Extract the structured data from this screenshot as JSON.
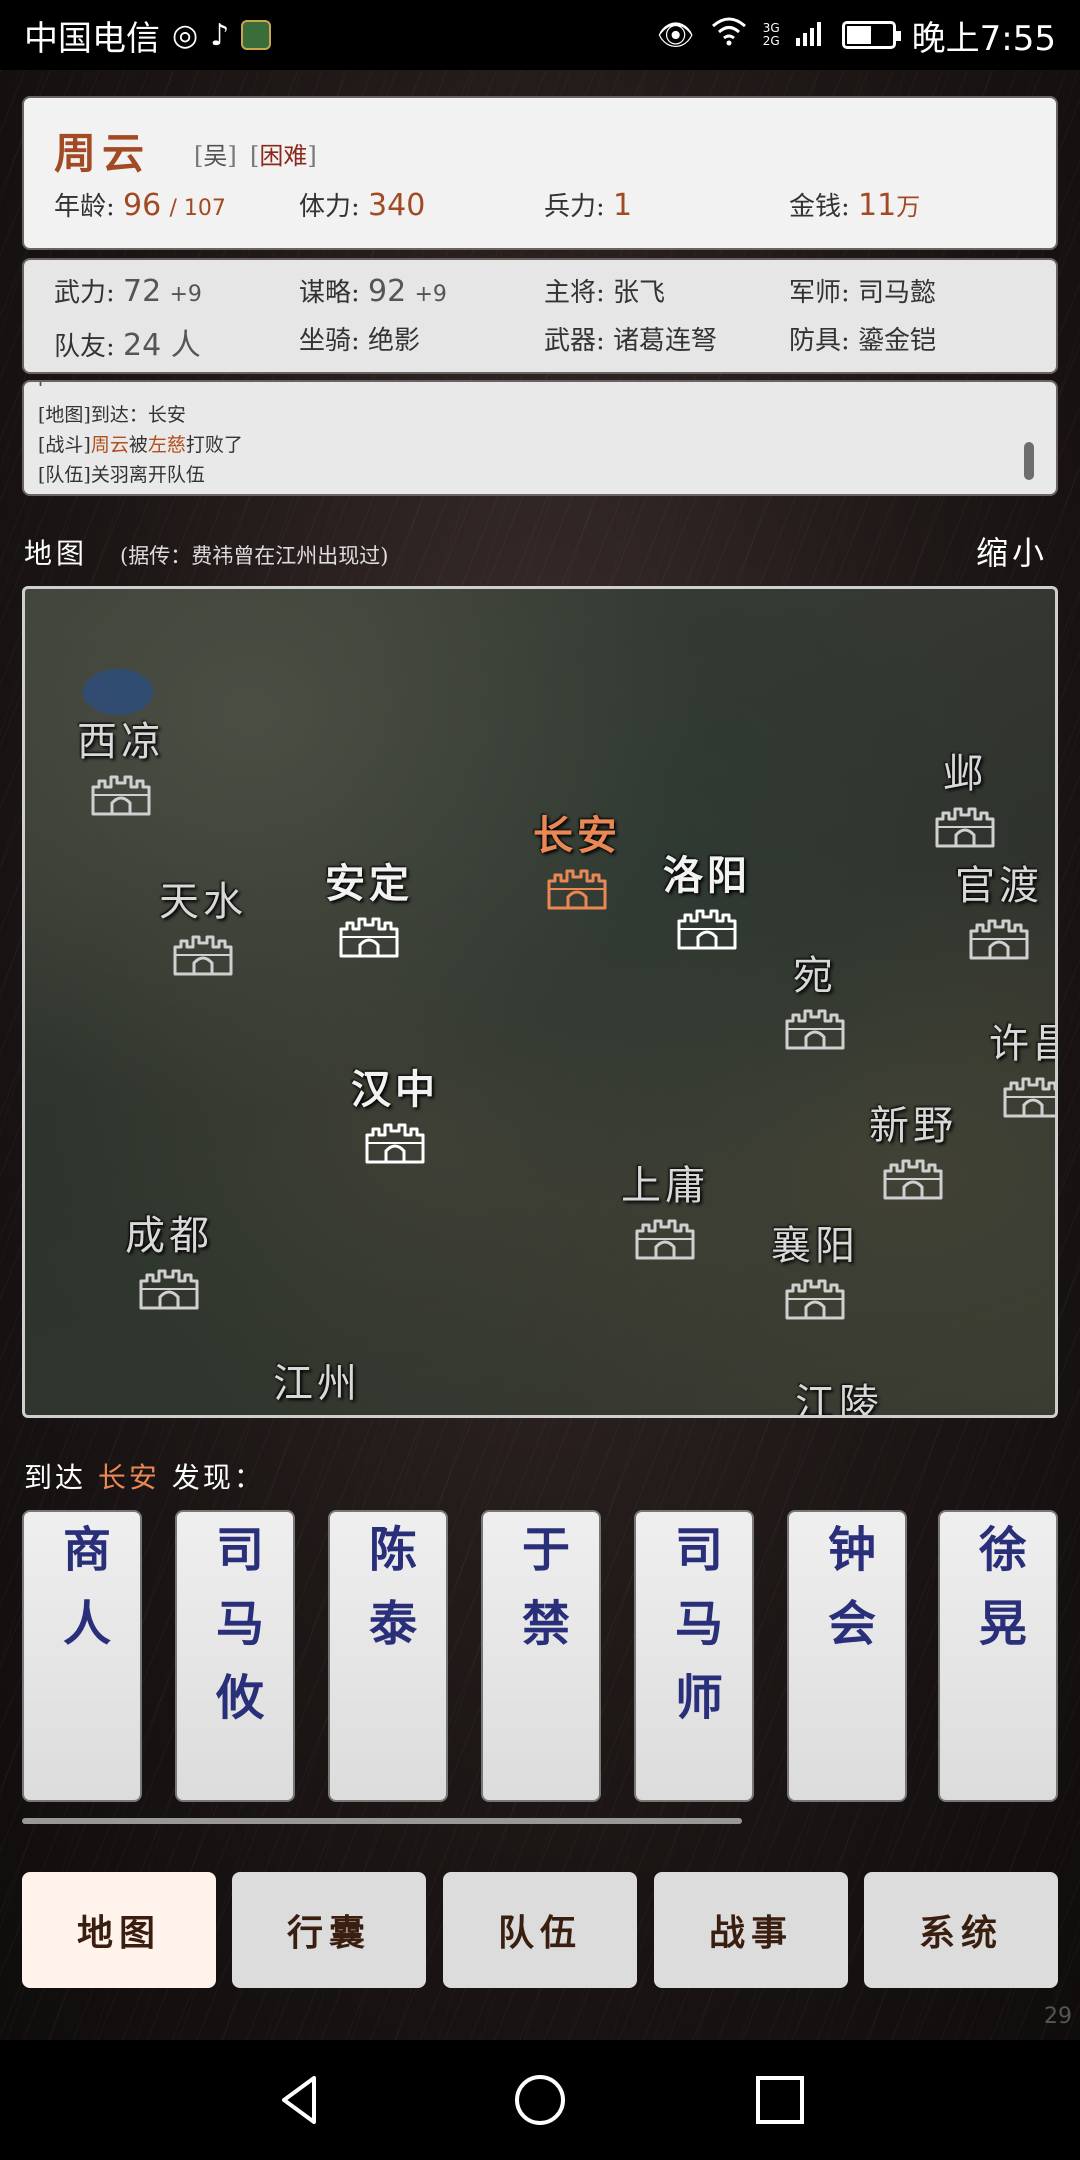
{
  "status_bar": {
    "carrier": "中国电信",
    "time": "晚上7:55",
    "network_label_top": "3G",
    "network_label_bottom": "2G",
    "battery_level": 0.55
  },
  "hero": {
    "name": "周云",
    "kingdom": "吴",
    "difficulty": "困难",
    "age_label": "年龄",
    "age_value": "96",
    "age_max": "/ 107",
    "stamina_label": "体力",
    "stamina_value": "340",
    "troops_label": "兵力",
    "troops_value": "1",
    "money_label": "金钱",
    "money_value": "11",
    "money_unit": "万"
  },
  "attributes": {
    "might_label": "武力",
    "might_value": "72",
    "might_bonus": "+9",
    "strategy_label": "谋略",
    "strategy_value": "92",
    "strategy_bonus": "+9",
    "general_label": "主将",
    "general_value": "张飞",
    "advisor_label": "军师",
    "advisor_value": "司马懿",
    "teammates_label": "队友",
    "teammates_value": "24 人",
    "mount_label": "坐骑",
    "mount_value": "绝影",
    "weapon_label": "武器",
    "weapon_value": "诸葛连弩",
    "armor_label": "防具",
    "armor_value": "鎏金铠"
  },
  "log": {
    "line1_tag": "[地图]",
    "line1_text": "到达：长安",
    "line2_tag": "[战斗]",
    "line2_a": "周云",
    "line2_b": "被",
    "line2_c": "左慈",
    "line2_d": "打败了",
    "line3_tag": "[队伍]",
    "line3_text": "关羽离开队伍"
  },
  "map": {
    "title": "地图",
    "rumor": "(据传：费祎曾在江州出现过)",
    "zoom_label": "缩小",
    "cities": {
      "xiliang": "西凉",
      "tianshui": "天水",
      "anding": "安定",
      "changan": "长安",
      "luoyang": "洛阳",
      "ye": "邺",
      "guandu": "官渡",
      "wan": "宛",
      "xuchang": "许昌",
      "hanzhong": "汉中",
      "xinye": "新野",
      "shangyong": "上庸",
      "xiangyang": "襄阳",
      "chengdu": "成都",
      "jiangzhou": "江州",
      "jiangling": "江陵"
    }
  },
  "found": {
    "prefix": "到达",
    "place": "长安",
    "suffix": "发现："
  },
  "npcs": [
    "商人",
    "司马攸",
    "陈泰",
    "于禁",
    "司马师",
    "钟会",
    "徐晃"
  ],
  "tabs": {
    "map": "地图",
    "bag": "行囊",
    "team": "队伍",
    "war": "战事",
    "system": "系统"
  },
  "build_number": "29"
}
